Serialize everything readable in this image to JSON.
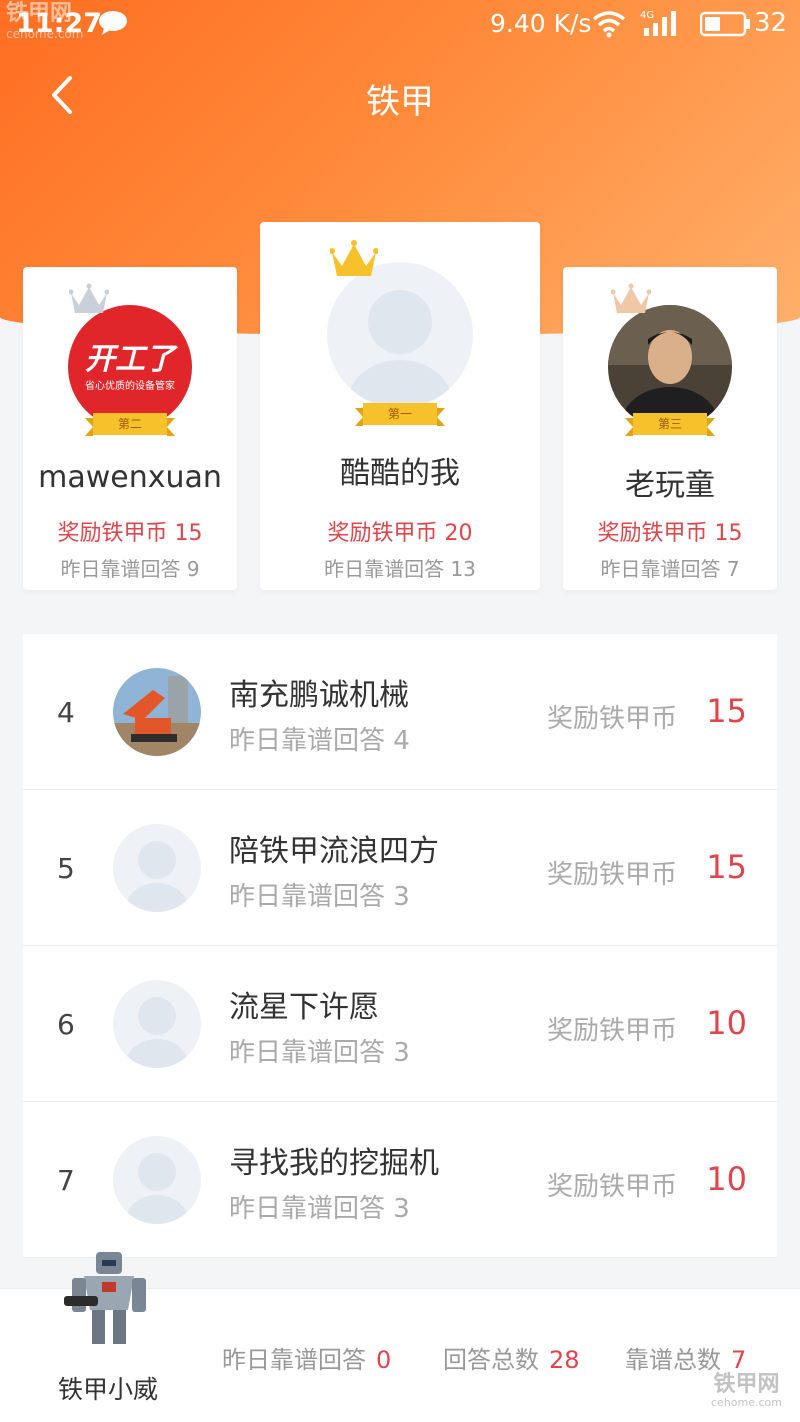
{
  "status_bar": {
    "time": "11:27",
    "network_speed": "9.40 K/s",
    "network_type": "4G",
    "battery": "32"
  },
  "watermark": {
    "brand": "铁甲网",
    "domain": "cehome.com"
  },
  "header": {
    "title": "铁甲"
  },
  "podium": [
    {
      "rank_label": "第二",
      "name": "mawenxuan",
      "reward_label": "奖励铁甲币",
      "reward": "15",
      "answers_label": "昨日靠谱回答",
      "answers": "9",
      "crown_color": "#c9d0da",
      "avatar_text": "开工了",
      "avatar_subtext": "省心优质的设备管家"
    },
    {
      "rank_label": "第一",
      "name": "酷酷的我",
      "reward_label": "奖励铁甲币",
      "reward": "20",
      "answers_label": "昨日靠谱回答",
      "answers": "13",
      "crown_color": "#f6c12a"
    },
    {
      "rank_label": "第三",
      "name": "老玩童",
      "reward_label": "奖励铁甲币",
      "reward": "15",
      "answers_label": "昨日靠谱回答",
      "answers": "7",
      "crown_color": "#f0c8a8"
    }
  ],
  "ranking_list": [
    {
      "rank": "4",
      "name": "南充鹏诚机械",
      "answers_label": "昨日靠谱回答",
      "answers": "4",
      "reward_label": "奖励铁甲币",
      "reward": "15"
    },
    {
      "rank": "5",
      "name": "陪铁甲流浪四方",
      "answers_label": "昨日靠谱回答",
      "answers": "3",
      "reward_label": "奖励铁甲币",
      "reward": "15"
    },
    {
      "rank": "6",
      "name": "流星下许愿",
      "answers_label": "昨日靠谱回答",
      "answers": "3",
      "reward_label": "奖励铁甲币",
      "reward": "10"
    },
    {
      "rank": "7",
      "name": "寻找我的挖掘机",
      "answers_label": "昨日靠谱回答",
      "answers": "3",
      "reward_label": "奖励铁甲币",
      "reward": "10"
    }
  ],
  "bottom_bar": {
    "name": "铁甲小威",
    "stats": [
      {
        "label": "昨日靠谱回答",
        "value": "0"
      },
      {
        "label": "回答总数",
        "value": "28"
      },
      {
        "label": "靠谱总数",
        "value": "7"
      }
    ]
  },
  "colors": {
    "accent": "#ff7a2e",
    "highlight": "#e0454b"
  }
}
